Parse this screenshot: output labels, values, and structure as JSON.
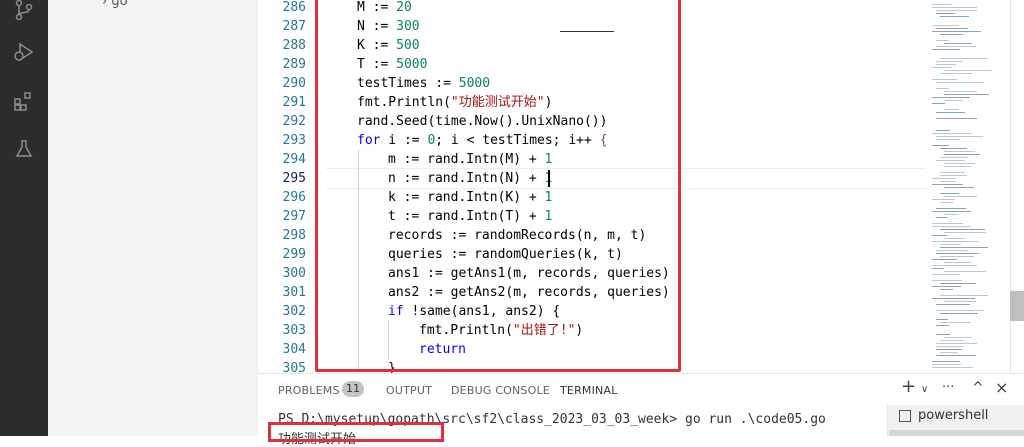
{
  "editor": {
    "line_numbers": [
      "286",
      "287",
      "288",
      "289",
      "290",
      "291",
      "292",
      "293",
      "294",
      "295",
      "296",
      "297",
      "298",
      "299",
      "300",
      "301",
      "302",
      "303",
      "304",
      "305"
    ],
    "active_line": "295",
    "code": [
      {
        "kind": "assign",
        "text": "M := ",
        "num": "20"
      },
      {
        "kind": "assign",
        "text": "N := ",
        "num": "300"
      },
      {
        "kind": "assign",
        "text": "K := ",
        "num": "500"
      },
      {
        "kind": "assign",
        "text": "T := ",
        "num": "5000"
      },
      {
        "kind": "assign",
        "text": "testTimes := ",
        "num": "5000"
      },
      {
        "kind": "print",
        "pre": "fmt.Println(",
        "str": "\"功能测试开始\"",
        "post": ")"
      },
      {
        "kind": "plain",
        "text": "rand.Seed(time.Now().UnixNano())"
      },
      {
        "kind": "for",
        "kw": "for",
        "pre": " i := ",
        "num1": "0",
        "mid": "; i < testTimes; i++ ",
        "brace": "{"
      },
      {
        "kind": "rand",
        "pre": "m := rand.Intn(M) + ",
        "num": "1"
      },
      {
        "kind": "rand",
        "pre": "n := rand.Intn(N) + ",
        "num": "1"
      },
      {
        "kind": "rand",
        "pre": "k := rand.Intn(K) + ",
        "num": "1"
      },
      {
        "kind": "rand",
        "pre": "t := rand.Intn(T) + ",
        "num": "1"
      },
      {
        "kind": "plain",
        "text": "records := randomRecords(n, m, t)"
      },
      {
        "kind": "plain",
        "text": "queries := randomQueries(k, t)"
      },
      {
        "kind": "plain",
        "text": "ans1 := getAns1(m, records, queries)"
      },
      {
        "kind": "plain",
        "text": "ans2 := getAns2(m, records, queries)"
      },
      {
        "kind": "if",
        "kw": "if",
        "rest": " !same(ans1, ans2) {"
      },
      {
        "kind": "print",
        "pre": "fmt.Println(",
        "str": "\"出错了!\"",
        "post": ")"
      },
      {
        "kind": "kwonly",
        "kw": "return"
      },
      {
        "kind": "plain",
        "text": "}"
      }
    ]
  },
  "panel": {
    "tabs": [
      "PROBLEMS",
      "OUTPUT",
      "DEBUG CONSOLE",
      "TERMINAL"
    ],
    "problems_count": "11",
    "active_tab": "TERMINAL",
    "actions": {
      "add": "+",
      "dropdown": "∨",
      "more": "···",
      "maximize": "^",
      "close": "×"
    }
  },
  "terminal": {
    "prompt_line": "PS D:\\mysetup\\gopath\\src\\sf2\\class_2023_03_03_week> go run .\\code05.go",
    "output_line": "功能测试开始",
    "shells": [
      "powershell"
    ]
  },
  "sidebar": {
    "partial_label": "› go"
  },
  "colors": {
    "highlight": "#e0303a",
    "keyword": "#0000ff",
    "number": "#098658",
    "string": "#a31515",
    "line_number": "#237893"
  }
}
